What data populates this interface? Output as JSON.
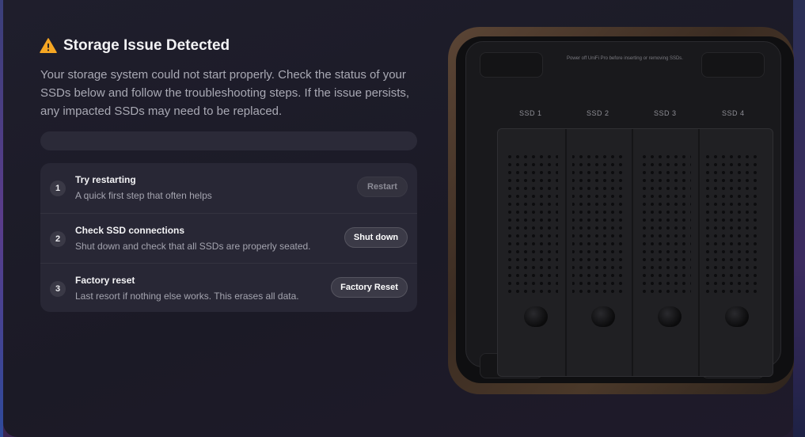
{
  "alert": {
    "icon": "warning-icon",
    "title": "Storage Issue Detected",
    "description": "Your storage system could not start properly. Check the status of your SSDs below and follow the troubleshooting steps. If the issue persists, any impacted SSDs may need to be replaced."
  },
  "progress": {
    "value": 0
  },
  "steps": [
    {
      "number": "1",
      "title": "Try restarting",
      "description": "A quick first step that often helps",
      "button": "Restart",
      "button_enabled": false
    },
    {
      "number": "2",
      "title": "Check SSD connections",
      "description": "Shut down and check that all SSDs are properly seated.",
      "button": "Shut down",
      "button_enabled": true
    },
    {
      "number": "3",
      "title": "Factory reset",
      "description": "Last resort if nothing else works. This erases all data.",
      "button": "Factory Reset",
      "button_enabled": true
    }
  ],
  "device": {
    "notice": "Power off UniFi Pro before inserting or removing SSDs.",
    "slots": [
      "SSD 1",
      "SSD 2",
      "SSD 3",
      "SSD 4"
    ]
  },
  "colors": {
    "warning": "#f5a623",
    "accent_bg": "#282735"
  }
}
